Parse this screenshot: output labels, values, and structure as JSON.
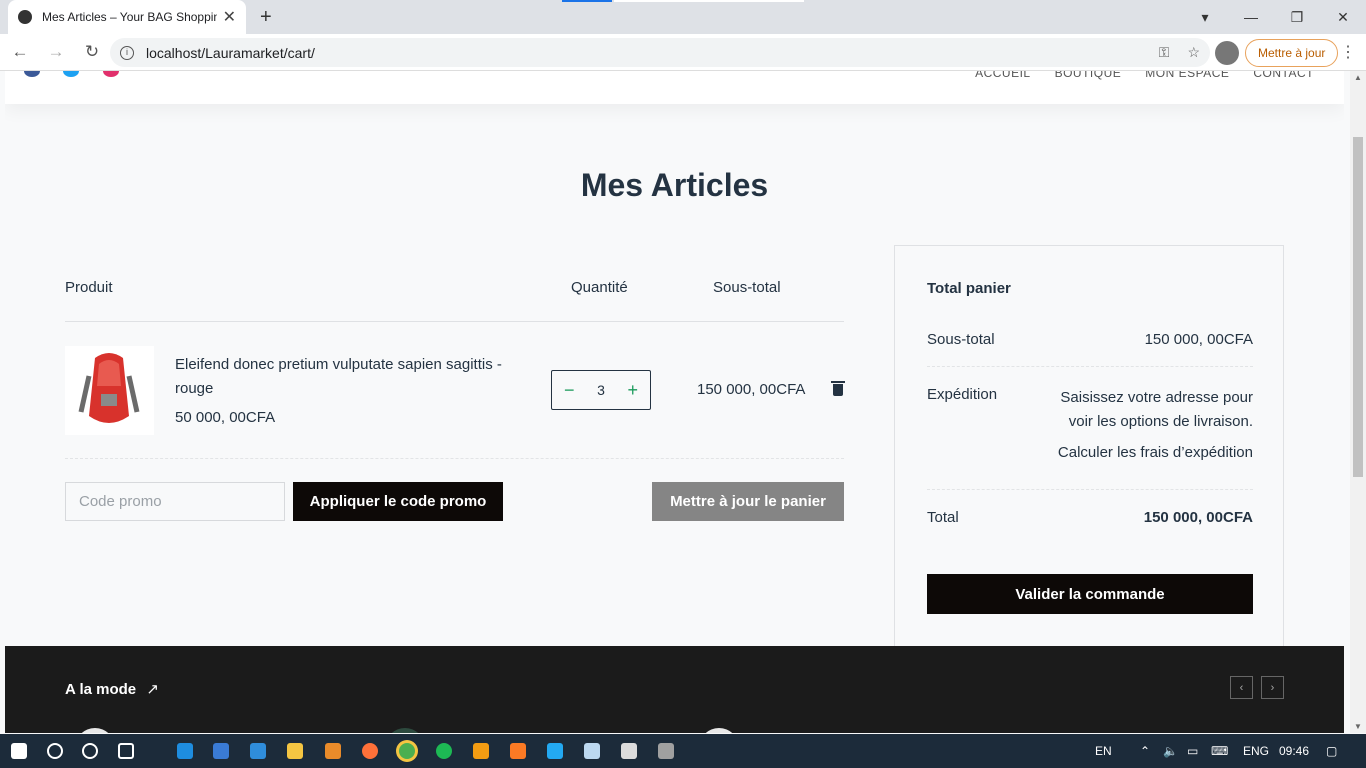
{
  "browser": {
    "tab_title": "Mes Articles – Your BAG Shoppin",
    "url": "localhost/Lauramarket/cart/",
    "update_label": "Mettre à jour"
  },
  "site": {
    "nav": [
      "ACCUEIL",
      "BOUTIQUE",
      "MON ESPACE",
      "CONTACT"
    ]
  },
  "cart": {
    "title": "Mes Articles",
    "headers": {
      "product": "Produit",
      "quantity": "Quantité",
      "subtotal": "Sous-total"
    },
    "item": {
      "name": "Eleifend donec pretium vulputate sapien sagittis - rouge",
      "price": "50 000, 00CFA",
      "quantity": "3",
      "subtotal": "150 000, 00CFA"
    },
    "promo_placeholder": "Code promo",
    "apply_promo_label": "Appliquer le code promo",
    "update_cart_label": "Mettre à jour le panier"
  },
  "totals": {
    "title": "Total panier",
    "subtotal_label": "Sous-total",
    "subtotal_value": "150 000, 00CFA",
    "shipping_label": "Expédition",
    "shipping_note": "Saisissez votre adresse pour voir les options de livraison.",
    "shipping_calc": "Calculer les frais d’expédition",
    "total_label": "Total",
    "total_value": "150 000, 00CFA",
    "checkout_label": "Valider la commande"
  },
  "footer": {
    "trending_label": "A la mode"
  },
  "taskbar": {
    "lang": "EN",
    "lang2": "ENG",
    "time": "09:46"
  },
  "colors": {
    "heading": "#243342",
    "dark_button": "#0d0907",
    "grey_button": "#858585",
    "qty_accent": "#1a9a5b",
    "footer_bg": "#1b1b1b"
  }
}
